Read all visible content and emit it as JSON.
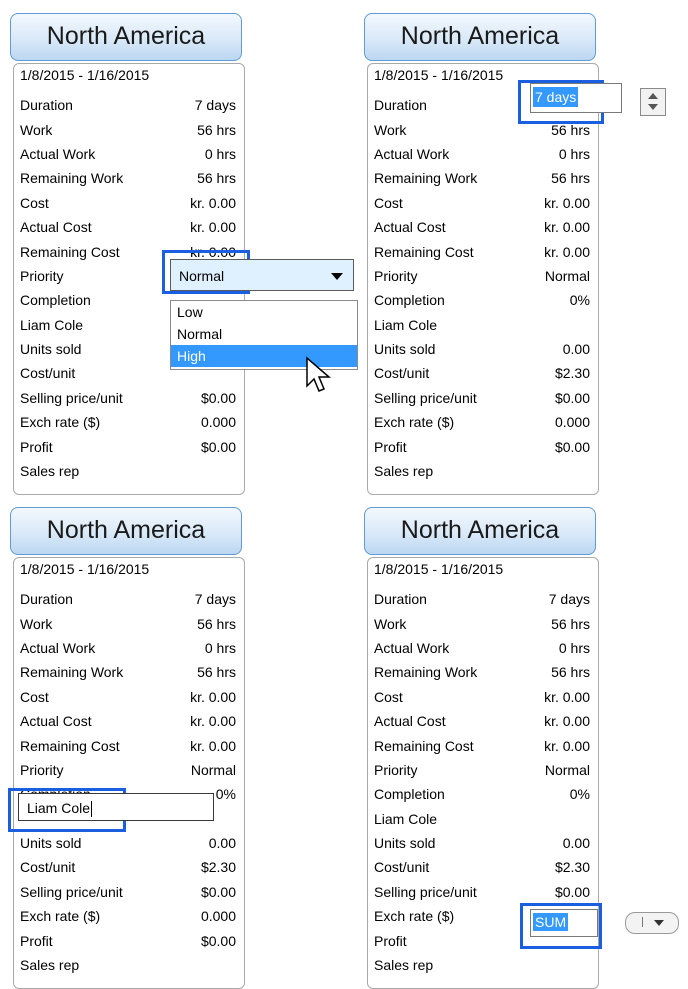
{
  "header_title": "North America",
  "date_range": "1/8/2015 - 1/16/2015",
  "colors": {
    "selection": "#1a5fe0",
    "highlight": "#3399ff",
    "header_bg": "#d9e9f8"
  },
  "panels": [
    {
      "rows": [
        {
          "label": "Duration",
          "value": "7 days"
        },
        {
          "label": "Work",
          "value": "56 hrs"
        },
        {
          "label": "Actual Work",
          "value": "0 hrs"
        },
        {
          "label": "Remaining Work",
          "value": "56 hrs"
        },
        {
          "label": "Cost",
          "value": "kr. 0.00"
        },
        {
          "label": "Actual Cost",
          "value": "kr. 0.00"
        },
        {
          "label": "Remaining Cost",
          "value": "kr. 0.00"
        },
        {
          "label": "Priority",
          "value": ""
        },
        {
          "label": "Completion",
          "value": ""
        },
        {
          "label": "Liam Cole",
          "value": ""
        },
        {
          "label": "Units sold",
          "value": ""
        },
        {
          "label": "Cost/unit",
          "value": ""
        },
        {
          "label": "Selling price/unit",
          "value": "$0.00"
        },
        {
          "label": "Exch rate ($)",
          "value": "0.000"
        },
        {
          "label": "Profit",
          "value": "$0.00"
        },
        {
          "label": "Sales rep",
          "value": ""
        }
      ]
    },
    {
      "rows": [
        {
          "label": "Duration",
          "value": ""
        },
        {
          "label": "Work",
          "value": "56 hrs"
        },
        {
          "label": "Actual Work",
          "value": "0 hrs"
        },
        {
          "label": "Remaining Work",
          "value": "56 hrs"
        },
        {
          "label": "Cost",
          "value": "kr. 0.00"
        },
        {
          "label": "Actual Cost",
          "value": "kr. 0.00"
        },
        {
          "label": "Remaining Cost",
          "value": "kr. 0.00"
        },
        {
          "label": "Priority",
          "value": "Normal"
        },
        {
          "label": "Completion",
          "value": "0%"
        },
        {
          "label": "Liam Cole",
          "value": ""
        },
        {
          "label": "Units sold",
          "value": "0.00"
        },
        {
          "label": "Cost/unit",
          "value": "$2.30"
        },
        {
          "label": "Selling price/unit",
          "value": "$0.00"
        },
        {
          "label": "Exch rate ($)",
          "value": "0.000"
        },
        {
          "label": "Profit",
          "value": "$0.00"
        },
        {
          "label": "Sales rep",
          "value": ""
        }
      ]
    },
    {
      "rows": [
        {
          "label": "Duration",
          "value": "7 days"
        },
        {
          "label": "Work",
          "value": "56 hrs"
        },
        {
          "label": "Actual Work",
          "value": "0 hrs"
        },
        {
          "label": "Remaining Work",
          "value": "56 hrs"
        },
        {
          "label": "Cost",
          "value": "kr. 0.00"
        },
        {
          "label": "Actual Cost",
          "value": "kr. 0.00"
        },
        {
          "label": "Remaining Cost",
          "value": "kr. 0.00"
        },
        {
          "label": "Priority",
          "value": "Normal"
        },
        {
          "label": "Completion",
          "value": "0%"
        },
        {
          "label": "",
          "value": ""
        },
        {
          "label": "Units sold",
          "value": "0.00"
        },
        {
          "label": "Cost/unit",
          "value": "$2.30"
        },
        {
          "label": "Selling price/unit",
          "value": "$0.00"
        },
        {
          "label": "Exch rate ($)",
          "value": "0.000"
        },
        {
          "label": "Profit",
          "value": "$0.00"
        },
        {
          "label": "Sales rep",
          "value": ""
        }
      ]
    },
    {
      "rows": [
        {
          "label": "Duration",
          "value": "7 days"
        },
        {
          "label": "Work",
          "value": "56 hrs"
        },
        {
          "label": "Actual Work",
          "value": "0 hrs"
        },
        {
          "label": "Remaining Work",
          "value": "56 hrs"
        },
        {
          "label": "Cost",
          "value": "kr. 0.00"
        },
        {
          "label": "Actual Cost",
          "value": "kr. 0.00"
        },
        {
          "label": "Remaining Cost",
          "value": "kr. 0.00"
        },
        {
          "label": "Priority",
          "value": "Normal"
        },
        {
          "label": "Completion",
          "value": "0%"
        },
        {
          "label": "Liam Cole",
          "value": ""
        },
        {
          "label": "Units sold",
          "value": "0.00"
        },
        {
          "label": "Cost/unit",
          "value": "$2.30"
        },
        {
          "label": "Selling price/unit",
          "value": "$0.00"
        },
        {
          "label": "Exch rate ($)",
          "value": "0.000"
        },
        {
          "label": "Profit",
          "value": ""
        },
        {
          "label": "Sales rep",
          "value": ""
        }
      ]
    }
  ],
  "priority_dropdown": {
    "selected": "Normal",
    "options": [
      "Low",
      "Normal",
      "High"
    ],
    "highlighted": "High"
  },
  "duration_editor": {
    "value": "7 days"
  },
  "name_editor": {
    "value": "Liam Cole"
  },
  "profit_editor": {
    "value": "SUM"
  },
  "icons": {
    "cursor": "arrow-cursor-icon",
    "spin": "spin-updown-icon",
    "dropdown": "chevron-down-icon"
  }
}
